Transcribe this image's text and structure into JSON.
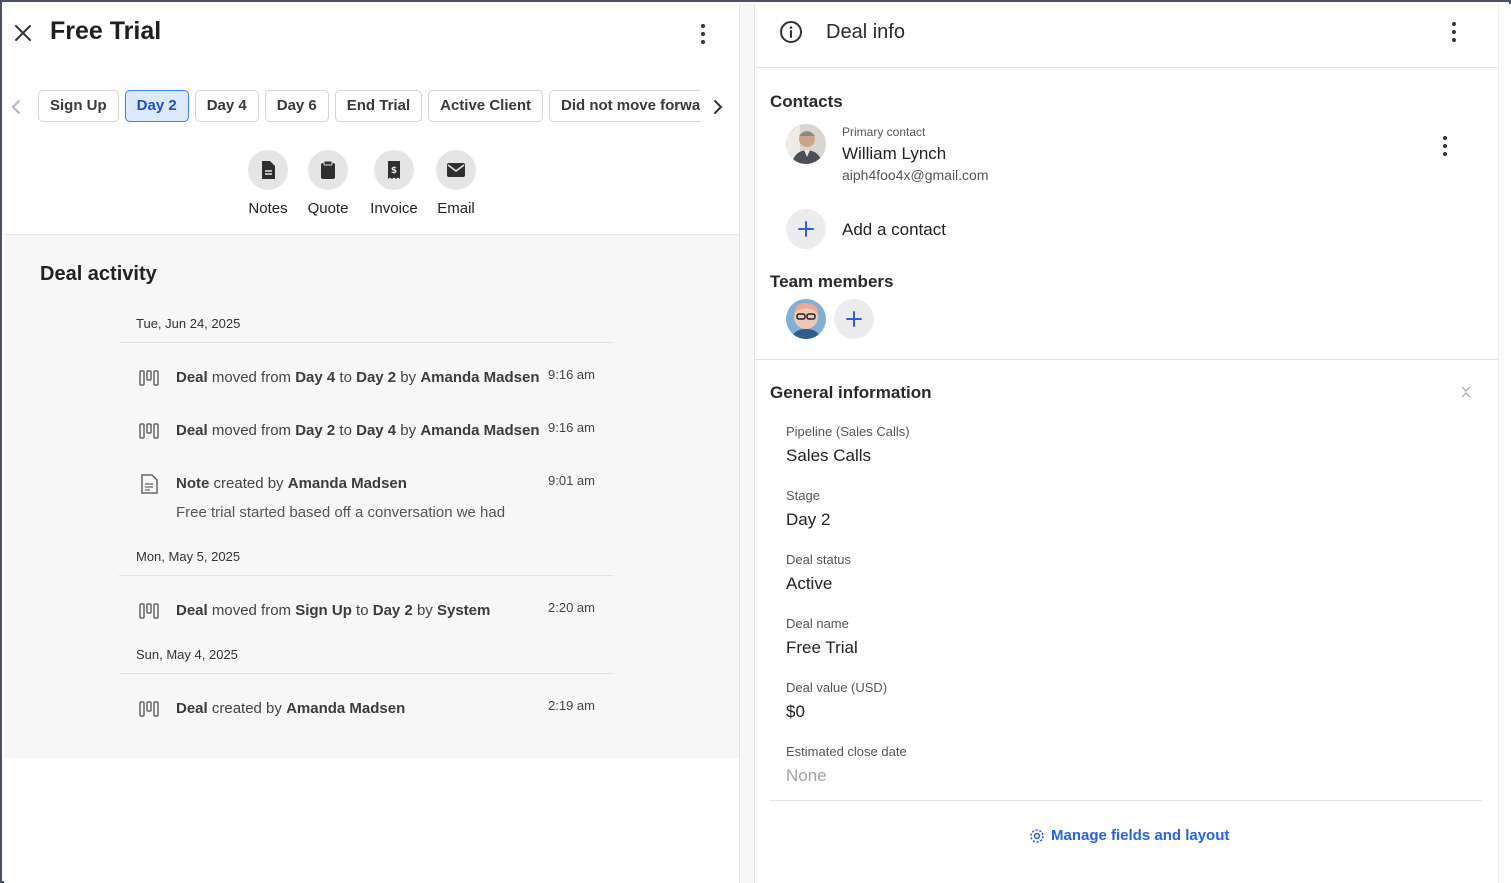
{
  "deal": {
    "title": "Free Trial"
  },
  "stages": {
    "items": [
      "Sign Up",
      "Day 2",
      "Day 4",
      "Day 6",
      "End Trial",
      "Active Client",
      "Did not move forward"
    ],
    "active": "Day 2"
  },
  "actions": {
    "notes": "Notes",
    "quote": "Quote",
    "invoice": "Invoice",
    "email": "Email"
  },
  "activity": {
    "title": "Deal activity",
    "groups": [
      {
        "date": "Tue, Jun 24, 2025",
        "entries": [
          {
            "icon": "pipeline-icon",
            "parts": [
              [
                "b",
                "Deal"
              ],
              [
                "t",
                " moved from "
              ],
              [
                "b",
                "Day 4"
              ],
              [
                "t",
                " to "
              ],
              [
                "b",
                "Day 2"
              ],
              [
                "t",
                " by "
              ],
              [
                "b",
                "Amanda Madsen"
              ]
            ],
            "time": "9:16 am"
          },
          {
            "icon": "pipeline-icon",
            "parts": [
              [
                "b",
                "Deal"
              ],
              [
                "t",
                " moved from "
              ],
              [
                "b",
                "Day 2"
              ],
              [
                "t",
                " to "
              ],
              [
                "b",
                "Day 4"
              ],
              [
                "t",
                " by "
              ],
              [
                "b",
                "Amanda Madsen"
              ]
            ],
            "time": "9:16 am"
          },
          {
            "icon": "note-icon",
            "parts": [
              [
                "b",
                "Note"
              ],
              [
                "t",
                " created by "
              ],
              [
                "b",
                "Amanda Madsen"
              ]
            ],
            "time": "9:01 am",
            "sub": "Free trial started based off a conversation we had"
          }
        ]
      },
      {
        "date": "Mon, May 5, 2025",
        "entries": [
          {
            "icon": "pipeline-icon",
            "parts": [
              [
                "b",
                "Deal"
              ],
              [
                "t",
                " moved from "
              ],
              [
                "b",
                "Sign Up"
              ],
              [
                "t",
                " to "
              ],
              [
                "b",
                "Day 2"
              ],
              [
                "t",
                " by "
              ],
              [
                "b",
                "System"
              ]
            ],
            "time": "2:20 am"
          }
        ]
      },
      {
        "date": "Sun, May 4, 2025",
        "entries": [
          {
            "icon": "pipeline-icon",
            "parts": [
              [
                "b",
                "Deal"
              ],
              [
                "t",
                " created by "
              ],
              [
                "b",
                "Amanda Madsen"
              ]
            ],
            "time": "2:19 am"
          }
        ]
      }
    ]
  },
  "info": {
    "title": "Deal info",
    "contacts_heading": "Contacts",
    "primary_label": "Primary contact",
    "contact_name": "William Lynch",
    "contact_email": "aiph4foo4x@gmail.com",
    "add_contact": "Add a contact",
    "team_heading": "Team members",
    "general_heading": "General information",
    "fields": [
      {
        "label": "Pipeline (Sales Calls)",
        "value": "Sales Calls"
      },
      {
        "label": "Stage",
        "value": "Day 2"
      },
      {
        "label": "Deal status",
        "value": "Active"
      },
      {
        "label": "Deal name",
        "value": "Free Trial"
      },
      {
        "label": "Deal value (USD)",
        "value": "$0"
      },
      {
        "label": "Estimated close date",
        "value": "None",
        "muted": true
      }
    ],
    "manage_link": "Manage fields and layout"
  },
  "colors": {
    "accent": "#2563eb",
    "active_stage_bg": "#dbeafe",
    "activity_bg": "#f7f7f8"
  }
}
